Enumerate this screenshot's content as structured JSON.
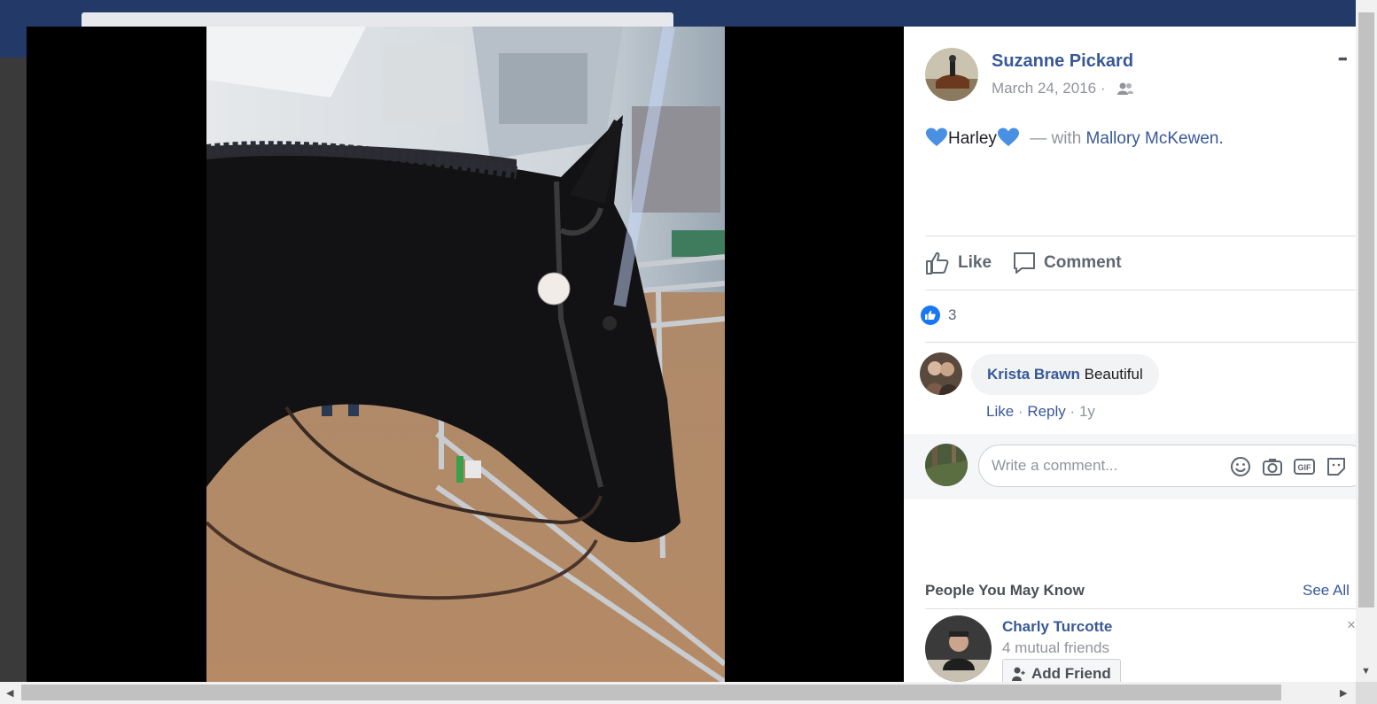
{
  "post": {
    "author": "Suzanne Pickard",
    "date": "March 24, 2016 ·",
    "more": "•••",
    "text": "Harley",
    "with_prefix": "— with",
    "tagged": "Mallory McKewen",
    "tagged_suffix": "."
  },
  "actions": {
    "like": "Like",
    "comment": "Comment"
  },
  "reactions": {
    "count": "3"
  },
  "comment": {
    "author": "Krista Brawn",
    "text": "Beautiful",
    "like": "Like",
    "sep1": "·",
    "reply": "Reply",
    "sep2": "·",
    "age": "1y"
  },
  "composer": {
    "placeholder": "Write a comment...",
    "gif": "GIF"
  },
  "pymk": {
    "title": "People You May Know",
    "see_all": "See All",
    "person": {
      "name": "Charly Turcotte",
      "mutual": "4 mutual friends",
      "add": "Add Friend",
      "close": "×"
    }
  },
  "colors": {
    "link": "#385898",
    "muted": "#90949c",
    "heart": "#4a90e2",
    "like_badge": "#1877f2",
    "header_bg": "#233a68"
  },
  "icons": [
    "blue-heart-icon",
    "friends-audience-icon",
    "thumbs-up-icon",
    "comment-bubble-icon",
    "like-badge-icon",
    "emoji-icon",
    "camera-icon",
    "gif-icon",
    "sticker-icon",
    "add-friend-icon"
  ]
}
